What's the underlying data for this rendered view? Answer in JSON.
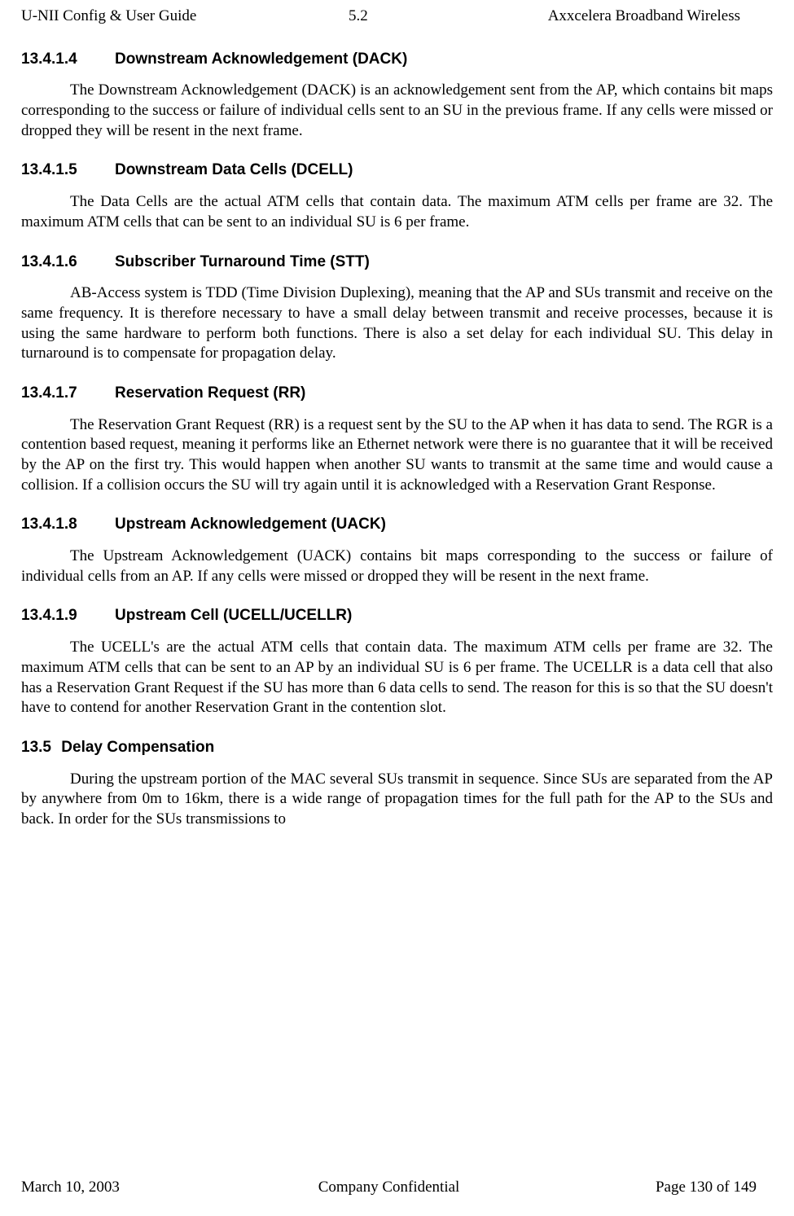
{
  "header": {
    "left": "U-NII Config & User Guide",
    "center": "5.2",
    "right": "Axxcelera Broadband Wireless"
  },
  "sections": [
    {
      "number": "13.4.1.4",
      "title": "Downstream Acknowledgement (DACK)",
      "body": "The Downstream Acknowledgement (DACK) is an acknowledgement sent from the AP, which contains bit maps corresponding to the success or failure of individual cells sent to an SU in the previous frame. If any cells were missed or dropped they will be resent in the next frame."
    },
    {
      "number": "13.4.1.5",
      "title": "Downstream Data Cells (DCELL)",
      "body": "The Data Cells are the actual ATM cells that contain data. The maximum ATM cells per frame are 32. The maximum ATM cells that can be sent to an individual SU is 6 per frame."
    },
    {
      "number": "13.4.1.6",
      "title": "Subscriber Turnaround Time (STT)",
      "body": "AB-Access system is TDD (Time Division Duplexing), meaning that the AP and SUs transmit and receive on the same frequency. It is therefore necessary to have a small delay between transmit and receive processes, because it is using the same hardware to perform both functions. There is also a set delay for each individual SU. This delay in turnaround is to compensate for propagation delay."
    },
    {
      "number": "13.4.1.7",
      "title": "Reservation Request (RR)",
      "body": "The Reservation Grant Request (RR) is a request sent by the SU to the AP when it has data to send. The RGR is a contention based request, meaning it performs like an Ethernet network were there is no guarantee that it will be received by the AP on the first try. This would happen when another SU wants to transmit at the same time and would cause a collision. If a collision occurs the SU will try again until it is acknowledged with a Reservation Grant Response."
    },
    {
      "number": "13.4.1.8",
      "title": "Upstream Acknowledgement (UACK)",
      "body": "The Upstream Acknowledgement (UACK) contains bit maps corresponding to the success or failure of individual cells from an AP. If any cells were missed or dropped they will be resent in the next frame."
    },
    {
      "number": "13.4.1.9",
      "title": "Upstream Cell (UCELL/UCELLR)",
      "body": "The UCELL's are the actual ATM cells that contain data. The maximum ATM cells per frame are 32. The maximum ATM cells that can be sent to an AP by an individual SU is 6 per frame. The UCELLR is a data cell that also has a Reservation Grant Request if the SU has more than 6 data cells to send. The reason for this is so that the SU doesn't have to contend for another Reservation Grant in the contention slot."
    },
    {
      "number": "13.5",
      "title": "Delay Compensation",
      "body": "During the upstream portion of the MAC several SUs transmit in sequence. Since SUs are separated from the AP by anywhere from 0m to 16km, there is a wide range of propagation times for the full path for the AP to the SUs and back. In order for the SUs transmissions to"
    }
  ],
  "footer": {
    "left": "March 10, 2003",
    "center": "Company Confidential",
    "right": "Page 130 of 149"
  }
}
